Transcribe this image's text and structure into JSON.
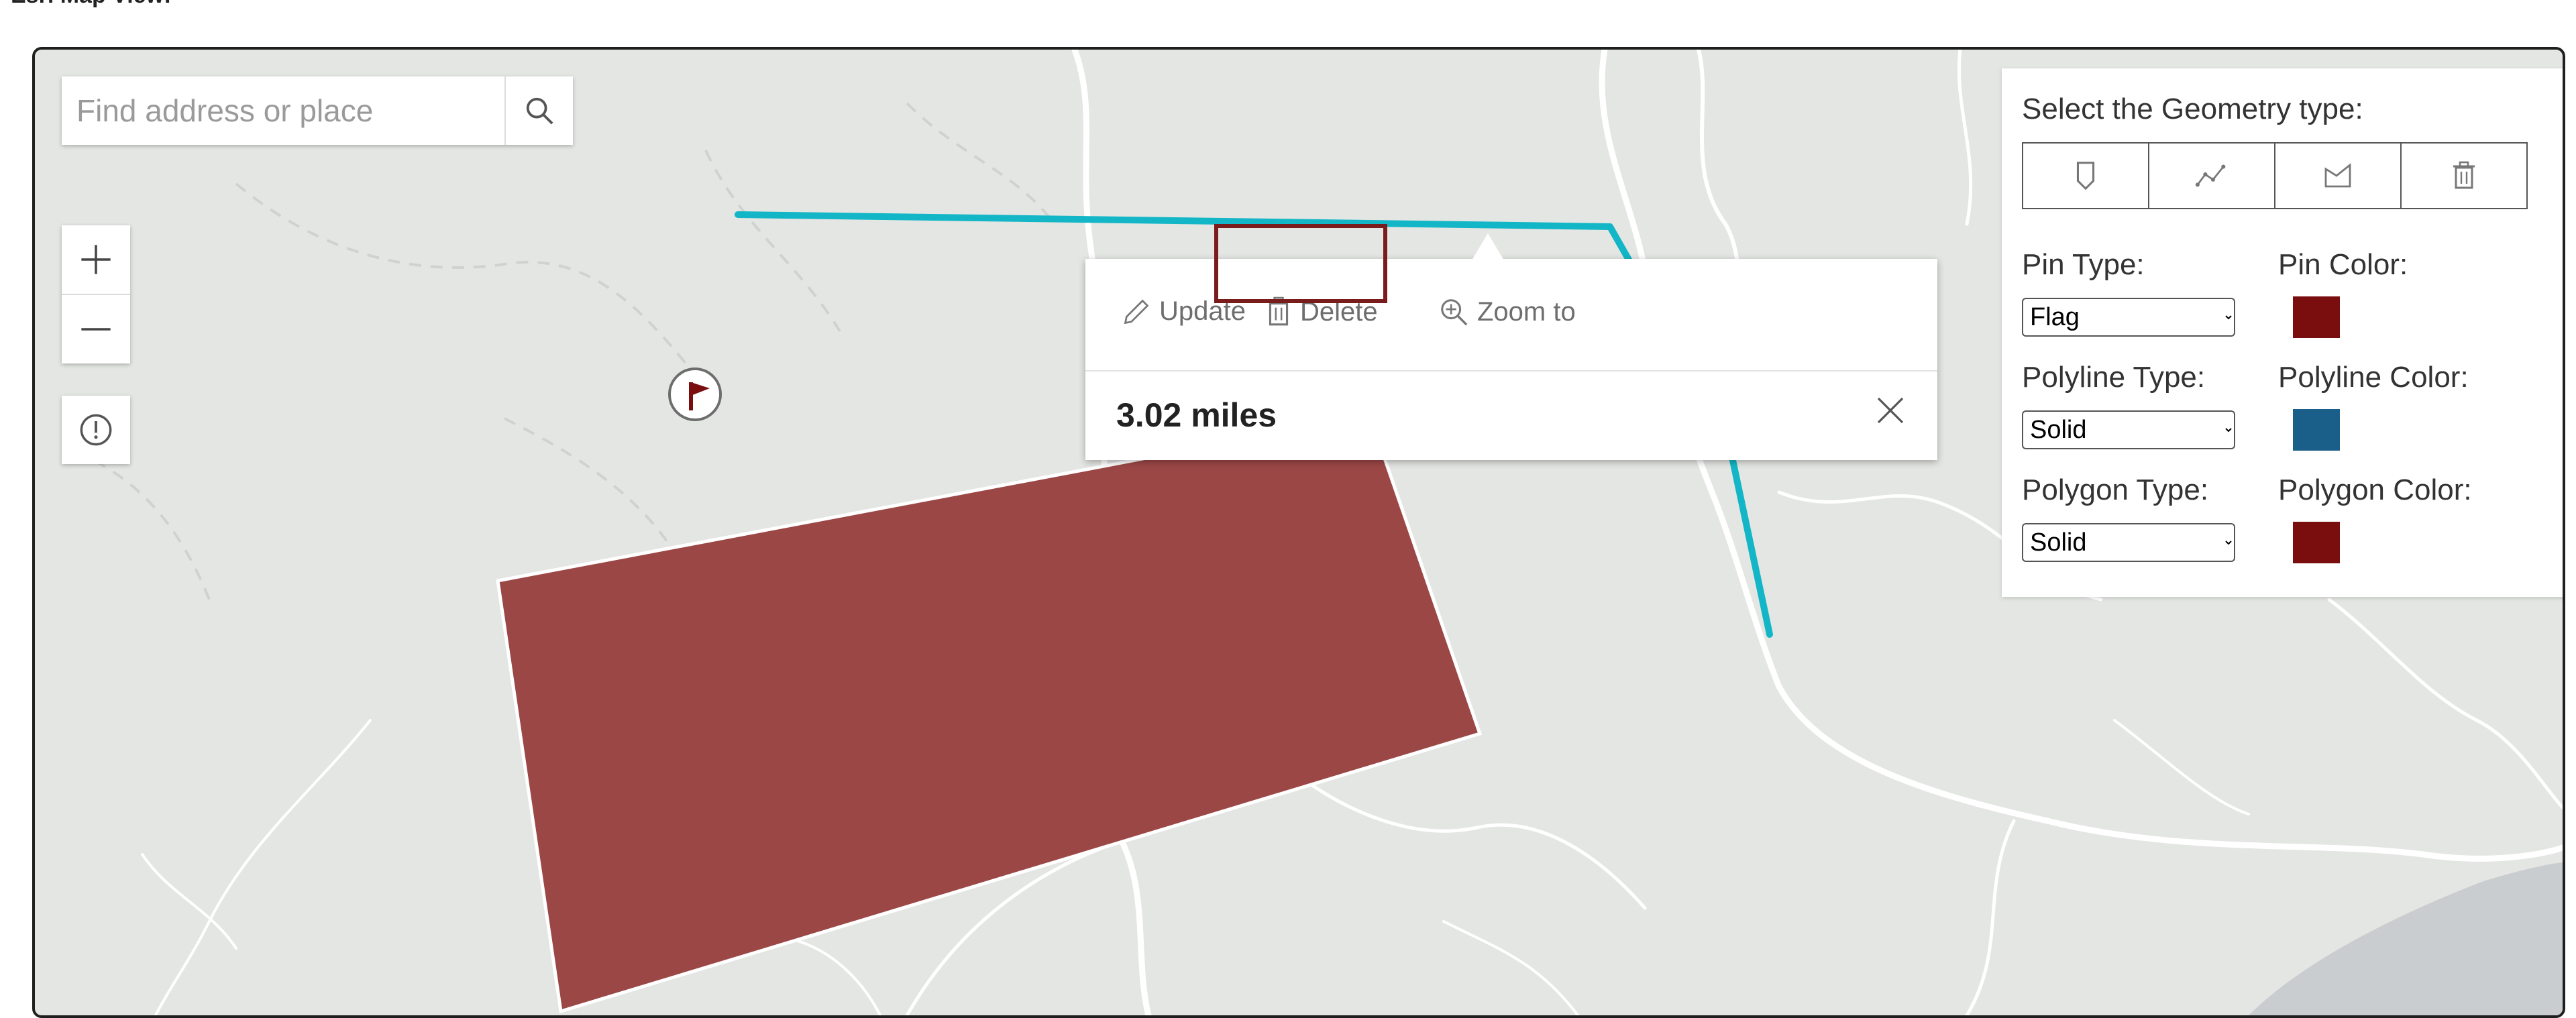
{
  "page": {
    "heading": "Esri Map View:"
  },
  "search": {
    "placeholder": "Find address or place"
  },
  "popup": {
    "actions": {
      "update": "Update",
      "delete": "Delete",
      "zoom_to": "Zoom to"
    },
    "title": "3.02 miles"
  },
  "panel": {
    "geometry_label": "Select the Geometry type:",
    "geometry_buttons": [
      "point-icon",
      "polyline-icon",
      "polygon-icon",
      "trash-icon"
    ],
    "pin_type_label": "Pin Type:",
    "pin_type_value": "Flag",
    "pin_color_label": "Pin Color:",
    "pin_color": "#7a0d0d",
    "polyline_type_label": "Polyline Type:",
    "polyline_type_value": "Solid",
    "polyline_color_label": "Polyline Color:",
    "polyline_color": "#1a5f8a",
    "polygon_type_label": "Polygon Type:",
    "polygon_type_value": "Solid",
    "polygon_color_label": "Polygon Color:",
    "polygon_color": "#7a0d0d"
  },
  "map": {
    "polyline_color": "#13b6c6",
    "polygon_fill": "#9b4746",
    "water_color": "#c9cdd0"
  }
}
